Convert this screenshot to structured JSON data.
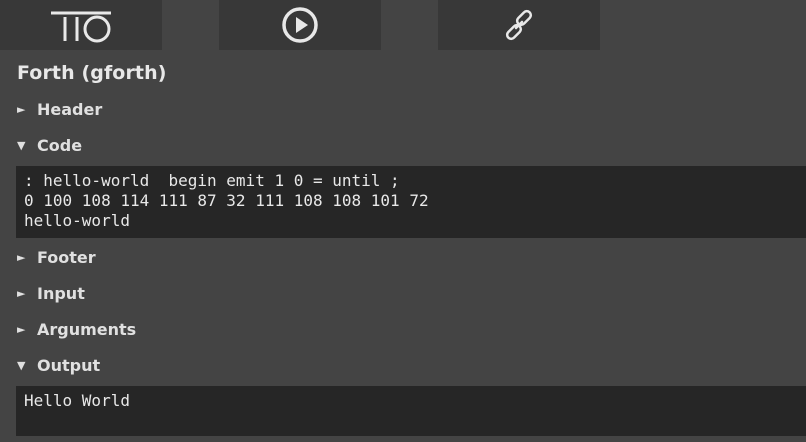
{
  "toolbar": {
    "home_icon": "tio-logo-icon",
    "run_icon": "play-icon",
    "link_icon": "chain-link-icon"
  },
  "language": {
    "title": "Forth (gforth)"
  },
  "sections": {
    "header": {
      "label": "Header",
      "arrow": "►",
      "expanded": false
    },
    "code": {
      "label": "Code",
      "arrow": "▼",
      "expanded": true
    },
    "footer": {
      "label": "Footer",
      "arrow": "►",
      "expanded": false
    },
    "input": {
      "label": "Input",
      "arrow": "►",
      "expanded": false
    },
    "arguments": {
      "label": "Arguments",
      "arrow": "►",
      "expanded": false
    },
    "output": {
      "label": "Output",
      "arrow": "▼",
      "expanded": true
    }
  },
  "code": {
    "lines": [
      ": hello-world  begin emit 1 0 = until ;",
      "0 100 108 114 111 87 32 111 108 108 101 72",
      "hello-world"
    ]
  },
  "output": {
    "text": "Hello World"
  },
  "colors": {
    "page_bg": "#444444",
    "panel_bg": "#383838",
    "editor_bg": "#262626",
    "text": "#e8e8e8"
  }
}
